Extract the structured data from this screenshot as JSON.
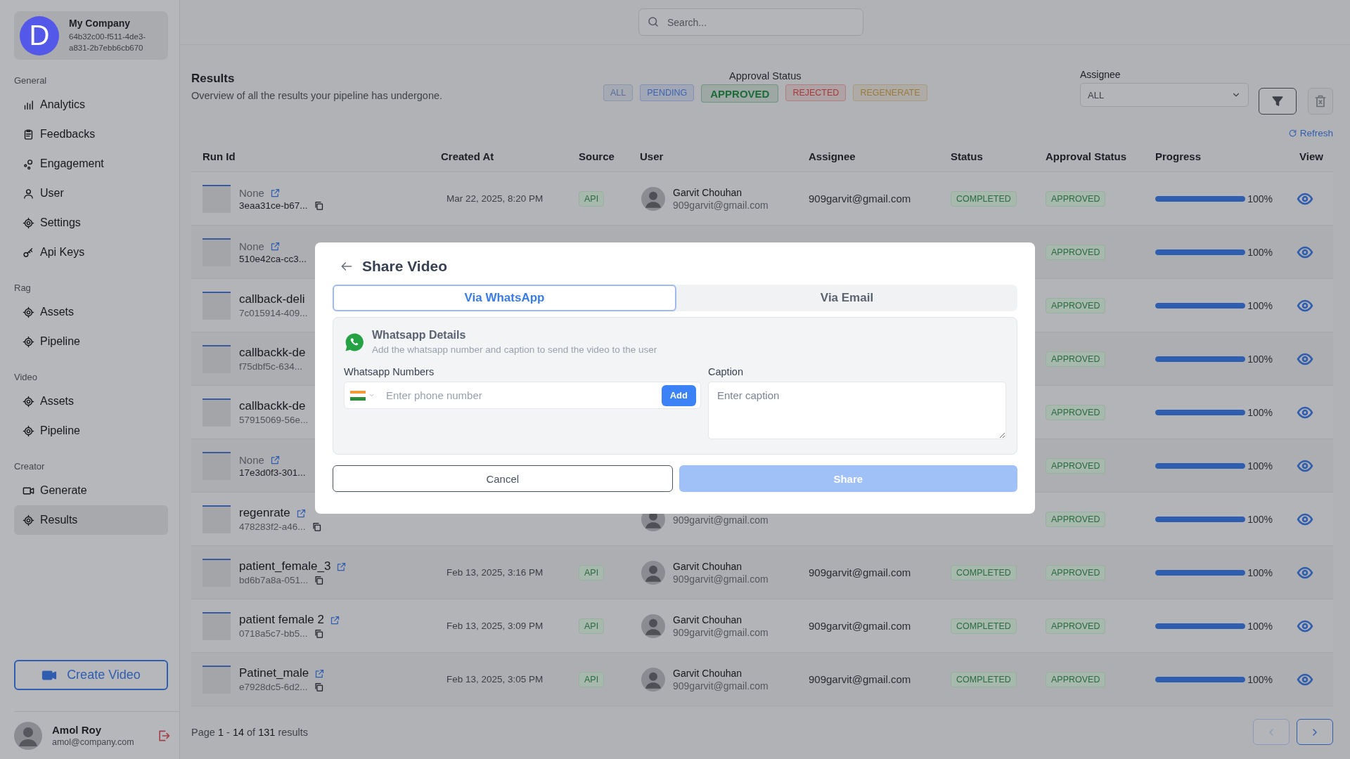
{
  "company": {
    "initial": "D",
    "name": "My Company",
    "id_text": "64b32c00-f511-4de3-a831-2b7ebb6cb670"
  },
  "sidebar": {
    "sections": [
      {
        "label": "General",
        "items": [
          {
            "label": "Analytics",
            "selected": false
          },
          {
            "label": "Feedbacks",
            "selected": false
          },
          {
            "label": "Engagement",
            "selected": false
          },
          {
            "label": "User",
            "selected": false
          },
          {
            "label": "Settings",
            "selected": false
          },
          {
            "label": "Api Keys",
            "selected": false
          }
        ]
      },
      {
        "label": "Rag",
        "items": [
          {
            "label": "Assets",
            "selected": false
          },
          {
            "label": "Pipeline",
            "selected": false
          }
        ]
      },
      {
        "label": "Video",
        "items": [
          {
            "label": "Assets",
            "selected": false
          },
          {
            "label": "Pipeline",
            "selected": false
          }
        ]
      },
      {
        "label": "Creator",
        "items": [
          {
            "label": "Generate",
            "selected": false
          },
          {
            "label": "Results",
            "selected": true
          }
        ]
      }
    ]
  },
  "create_button": "Create Video",
  "current_user": {
    "name": "Amol Roy",
    "email": "amol@company.com"
  },
  "search": {
    "placeholder": "Search..."
  },
  "results": {
    "title": "Results",
    "subtitle": "Overview of all the results your pipeline has undergone."
  },
  "approval_filter": {
    "label": "Approval Status",
    "chips": [
      {
        "label": "ALL",
        "selected": false,
        "color": "#5a6f9a"
      },
      {
        "label": "PENDING",
        "selected": false,
        "color": "#3f63b3"
      },
      {
        "label": "APPROVED",
        "selected": true,
        "color": "#1e6b3a"
      },
      {
        "label": "REJECTED",
        "selected": false,
        "color": "#a63a3a"
      },
      {
        "label": "REGENERATE",
        "selected": false,
        "color": "#9a7a3a"
      }
    ]
  },
  "assignee_filter": {
    "label": "Assignee",
    "value": "ALL"
  },
  "refresh": "Refresh",
  "table": {
    "columns": [
      "Run Id",
      "Created At",
      "Source",
      "User",
      "Assignee",
      "Status",
      "Approval Status",
      "Progress",
      "View"
    ],
    "rows": [
      {
        "name": "None",
        "name_muted": true,
        "link_icon": true,
        "run_id": "3eaa31ce-b67...",
        "copy_icon": true,
        "created_at": "Mar 22, 2025, 8:20 PM",
        "source": "API",
        "user_name": "Garvit Chouhan",
        "user_email": "909garvit@gmail.com",
        "assignee": "909garvit@gmail.com",
        "status": "COMPLETED",
        "approval": "APPROVED",
        "level": 1,
        "reading": "100%"
      },
      {
        "name": "None",
        "name_muted": true,
        "link_icon": true,
        "run_id": "510e42ca-cc3...",
        "copy_icon": false,
        "approval": "APPROVED",
        "level": 1,
        "reading": "100%"
      },
      {
        "name": "callback-deli",
        "name_muted": false,
        "link_icon": false,
        "run_id": "7c015914-409...",
        "copy_icon": false,
        "approval": "APPROVED",
        "level": 1,
        "reading": "100%"
      },
      {
        "name": "callbackk-de",
        "name_muted": false,
        "link_icon": false,
        "run_id": "f75dbf5c-634...",
        "copy_icon": false,
        "approval": "APPROVED",
        "level": 1,
        "reading": "100%"
      },
      {
        "name": "callbackk-de",
        "name_muted": false,
        "link_icon": false,
        "run_id": "57915069-56e...",
        "copy_icon": false,
        "approval": "APPROVED",
        "level": 1,
        "reading": "100%"
      },
      {
        "name": "None",
        "name_muted": true,
        "link_icon": true,
        "run_id": "17e3d0f3-301...",
        "copy_icon": false,
        "approval": "APPROVED",
        "level": 1,
        "reading": "100%"
      },
      {
        "name": "regenrate",
        "name_muted": false,
        "link_icon": true,
        "run_id": "478283f2-a46...",
        "copy_icon": true,
        "user_email": "909garvit@gmail.com",
        "approval": "APPROVED",
        "level": 1,
        "reading": "100%"
      },
      {
        "name": "patient_female_3",
        "name_muted": false,
        "link_icon": true,
        "run_id": "bd6b7a8a-051...",
        "copy_icon": true,
        "created_at": "Feb 13, 2025, 3:16 PM",
        "source": "API",
        "user_name": "Garvit Chouhan",
        "user_email": "909garvit@gmail.com",
        "assignee": "909garvit@gmail.com",
        "status": "COMPLETED",
        "approval": "APPROVED",
        "level": 1,
        "reading": "100%"
      },
      {
        "name": "patient female 2",
        "name_muted": false,
        "link_icon": true,
        "run_id": "0718a5c7-bb5...",
        "copy_icon": true,
        "created_at": "Feb 13, 2025, 3:09 PM",
        "source": "API",
        "user_name": "Garvit Chouhan",
        "user_email": "909garvit@gmail.com",
        "assignee": "909garvit@gmail.com",
        "status": "COMPLETED",
        "approval": "APPROVED",
        "level": 1,
        "reading": "100%"
      },
      {
        "name": "Patinet_male",
        "name_muted": false,
        "link_icon": true,
        "run_id": "e7928dc5-6d2...",
        "copy_icon": true,
        "created_at": "Feb 13, 2025, 3:05 PM",
        "source": "API",
        "user_name": "Garvit Chouhan",
        "user_email": "909garvit@gmail.com",
        "assignee": "909garvit@gmail.com",
        "status": "COMPLETED",
        "approval": "APPROVED",
        "level": 1,
        "reading": "100%"
      }
    ]
  },
  "pagination": {
    "text": "Page **1** - **14** of **131** results"
  },
  "modal": {
    "title": "Share Video",
    "tabs": [
      {
        "label": "Via WhatsApp",
        "selected": true
      },
      {
        "label": "Via Email",
        "selected": false
      }
    ],
    "details_title": "Whatsapp Details",
    "details_text": "Add the whatsapp number and caption to send the video to the user",
    "numbers_label": "Whatsapp Numbers",
    "phone_placeholder": "Enter phone number",
    "add_button": "Add",
    "caption_label": "Caption",
    "caption_placeholder": "Enter caption",
    "cancel_button": "Cancel",
    "share_button": "Share"
  }
}
